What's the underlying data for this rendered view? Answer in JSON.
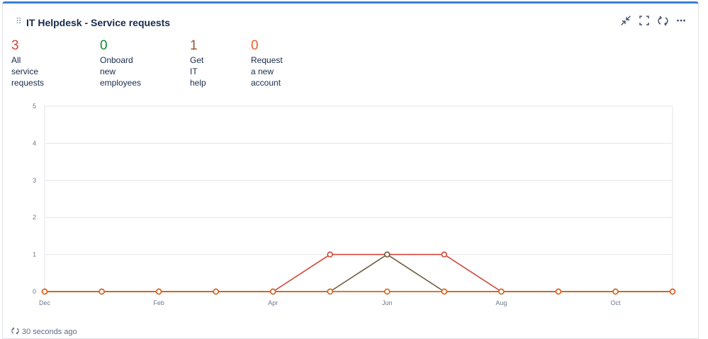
{
  "panel": {
    "title": "IT Helpdesk - Service requests"
  },
  "header_actions": [
    {
      "name": "minimize-icon"
    },
    {
      "name": "fullscreen-icon"
    },
    {
      "name": "refresh-icon"
    },
    {
      "name": "more-options-icon"
    }
  ],
  "stats": [
    {
      "value": "3",
      "label_line1": "All service requests",
      "label_line2": "",
      "color": "#d04437"
    },
    {
      "value": "0",
      "label_line1": "Onboard new",
      "label_line2": "employees",
      "color": "#14892c"
    },
    {
      "value": "1",
      "label_line1": "Get IT help",
      "label_line2": "",
      "color": "#a14d37"
    },
    {
      "value": "0",
      "label_line1": "Request a new",
      "label_line2": "account",
      "color": "#f15c27"
    }
  ],
  "chart_data": {
    "type": "line",
    "x": [
      0,
      1,
      2,
      3,
      4,
      5,
      6,
      7,
      8,
      9,
      10,
      11
    ],
    "x_tick_labels": [
      {
        "index": 0,
        "label": "Dec"
      },
      {
        "index": 2,
        "label": "Feb"
      },
      {
        "index": 4,
        "label": "Apr"
      },
      {
        "index": 6,
        "label": "Jun"
      },
      {
        "index": 8,
        "label": "Aug"
      },
      {
        "index": 10,
        "label": "Oct"
      }
    ],
    "ylim": [
      0,
      5
    ],
    "y_ticks": [
      0,
      1,
      2,
      3,
      4,
      5
    ],
    "grid": true,
    "series": [
      {
        "color": "#d04437",
        "values": [
          0,
          0,
          0,
          0,
          0,
          1,
          1,
          1,
          0,
          0,
          0,
          0
        ]
      },
      {
        "color": "#14892c",
        "values": [
          0,
          0,
          0,
          0,
          0,
          0,
          0,
          0,
          0,
          0,
          0,
          0
        ]
      },
      {
        "color": "#705a3c",
        "values": [
          0,
          0,
          0,
          0,
          0,
          0,
          1,
          0,
          0,
          0,
          0,
          0
        ]
      },
      {
        "color": "#e8631f",
        "values": [
          0,
          0,
          0,
          0,
          0,
          0,
          0,
          0,
          0,
          0,
          0,
          0
        ]
      }
    ]
  },
  "footer": {
    "refreshed_text": "30 seconds ago"
  },
  "colors": {
    "accent": "#3b7fdb",
    "grid": "#e4e6ea",
    "axis_text": "#6b778c"
  }
}
